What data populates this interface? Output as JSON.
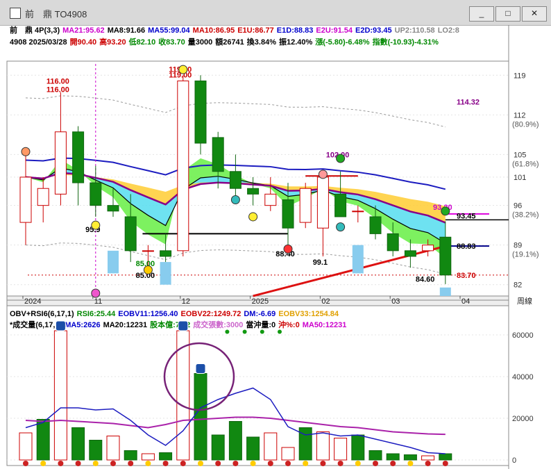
{
  "window": {
    "title": "前　鼎 TO4908",
    "buttons": [
      "_",
      "□",
      "✕"
    ]
  },
  "header": {
    "row1": [
      {
        "text": "前　鼎 4P(3,3)",
        "color": "#000000"
      },
      {
        "text": "MA21:95.62",
        "color": "#cc00cc"
      },
      {
        "text": "MA8:91.66",
        "color": "#000000"
      },
      {
        "text": "MA55:99.04",
        "color": "#0000cc"
      },
      {
        "text": "MA10:86.95",
        "color": "#cc0000"
      },
      {
        "text": "E1U:86.77",
        "color": "#cc0000"
      },
      {
        "text": "E1D:88.83",
        "color": "#0000cc"
      },
      {
        "text": "E2U:91.54",
        "color": "#cc00cc"
      },
      {
        "text": "E2D:93.45",
        "color": "#0000cc"
      },
      {
        "text": "UP2:110.58",
        "color": "#888888"
      },
      {
        "text": "LO2:8",
        "color": "#888888"
      }
    ],
    "row2": [
      {
        "text": "4908 2025/03/28",
        "color": "#000000"
      },
      {
        "text": "開90.40",
        "color": "#cc0000"
      },
      {
        "text": "高93.20",
        "color": "#cc0000"
      },
      {
        "text": "低82.10",
        "color": "#008800"
      },
      {
        "text": "收83.70",
        "color": "#008800"
      },
      {
        "text": "量3000",
        "color": "#000000"
      },
      {
        "text": "額26741",
        "color": "#000000"
      },
      {
        "text": "換3.84%",
        "color": "#000000"
      },
      {
        "text": "振12.40%",
        "color": "#000000"
      },
      {
        "text": "漲(-5.80)-6.48%",
        "color": "#008800"
      },
      {
        "text": "指數(-10.93)-4.31%",
        "color": "#008800"
      }
    ],
    "vol_row1": [
      {
        "text": "OBV+RSI6(6,17,1)",
        "color": "#000000"
      },
      {
        "text": "RSI6:25.44",
        "color": "#008800"
      },
      {
        "text": "EOBV11:1256.40",
        "color": "#0000cc"
      },
      {
        "text": "EOBV22:1249.72",
        "color": "#cc0000"
      },
      {
        "text": "DM:-6.69",
        "color": "#0000cc"
      },
      {
        "text": "EOBV33:1254.84",
        "color": "#e0a000"
      }
    ],
    "vol_row2": [
      {
        "text": "*成交量(6,17,1)",
        "color": "#000000"
      },
      {
        "text": "MA5:2626",
        "color": "#0000cc"
      },
      {
        "text": "MA20:12231",
        "color": "#000000"
      },
      {
        "text": "股本億:7.82",
        "color": "#008800"
      },
      {
        "text": "成交張數:3000",
        "color": "#cc66cc"
      },
      {
        "text": "當沖量:0",
        "color": "#000000"
      },
      {
        "text": "沖%:0",
        "color": "#cc0000"
      },
      {
        "text": "MA50:12231",
        "color": "#cc00cc"
      }
    ]
  },
  "chart_data": [
    {
      "type": "candlestick",
      "price_axis": {
        "ticks": [
          119,
          112,
          105,
          101,
          96,
          89,
          82
        ],
        "pct_labels": [
          {
            "price": 112,
            "text": "(80.9%)"
          },
          {
            "price": 105,
            "text": "(61.8%)"
          },
          {
            "price": 96,
            "text": "(38.2%)"
          },
          {
            "price": 89,
            "text": "(19.1%)"
          }
        ],
        "range": [
          80,
          121
        ]
      },
      "time_axis": [
        "2024",
        "11",
        "12",
        "2025",
        "02",
        "03",
        "04"
      ],
      "axis_title": "周線",
      "candles": [
        {
          "o": 93,
          "h": 106,
          "l": 89,
          "c": 101
        },
        {
          "o": 96,
          "h": 101,
          "l": 93,
          "c": 99
        },
        {
          "o": 98,
          "h": 116,
          "l": 96,
          "c": 109
        },
        {
          "o": 109,
          "h": 110,
          "l": 96,
          "c": 100
        },
        {
          "o": 100,
          "h": 103,
          "l": 94,
          "c": 96
        },
        {
          "o": 96,
          "h": 99,
          "l": 94,
          "c": 95
        },
        {
          "o": 94,
          "h": 98,
          "l": 86,
          "c": 88
        },
        {
          "o": 88,
          "h": 89,
          "l": 85,
          "c": 88
        },
        {
          "o": 88,
          "h": 91,
          "l": 86,
          "c": 87
        },
        {
          "o": 88,
          "h": 119,
          "l": 87,
          "c": 118
        },
        {
          "o": 118,
          "h": 119,
          "l": 105,
          "c": 107
        },
        {
          "o": 108,
          "h": 109,
          "l": 99,
          "c": 102
        },
        {
          "o": 102,
          "h": 105,
          "l": 97,
          "c": 99
        },
        {
          "o": 99,
          "h": 101,
          "l": 96,
          "c": 98
        },
        {
          "o": 96,
          "h": 101,
          "l": 95,
          "c": 98
        },
        {
          "o": 97,
          "h": 100,
          "l": 88,
          "c": 92
        },
        {
          "o": 93,
          "h": 100,
          "l": 92,
          "c": 99
        },
        {
          "o": 92,
          "h": 102,
          "l": 87,
          "c": 101
        },
        {
          "o": 98,
          "h": 102,
          "l": 94,
          "c": 94
        },
        {
          "o": 95,
          "h": 96,
          "l": 93,
          "c": 95
        },
        {
          "o": 94,
          "h": 96,
          "l": 90,
          "c": 91
        },
        {
          "o": 91,
          "h": 93,
          "l": 87,
          "c": 88
        },
        {
          "o": 88,
          "h": 90,
          "l": 85,
          "c": 87
        },
        {
          "o": 88,
          "h": 90,
          "l": 87,
          "c": 89
        },
        {
          "o": 90.4,
          "h": 93.2,
          "l": 82.1,
          "c": 83.7
        }
      ],
      "labels": [
        {
          "candle": 2,
          "price": 116,
          "text": "116.00",
          "color": "#cc0000"
        },
        {
          "candle": 2,
          "price": 117.5,
          "text": "116.00",
          "color": "#cc0000"
        },
        {
          "candle": 9,
          "price": 119.6,
          "text": "119.00",
          "color": "#cc0000"
        },
        {
          "candle": 9,
          "price": 118.6,
          "text": "119.00",
          "color": "#cc0000"
        },
        {
          "candle": 4,
          "price": 91.3,
          "text": "95.9",
          "color": "#000000"
        },
        {
          "candle": 7,
          "price": 83.2,
          "text": "85.00",
          "color": "#000000"
        },
        {
          "candle": 7,
          "price": 85.3,
          "text": "85.00",
          "color": "#008800"
        },
        {
          "candle": 15,
          "price": 87.0,
          "text": "88.40",
          "color": "#000000"
        },
        {
          "candle": 17,
          "price": 85.5,
          "text": "99.1",
          "color": "#000000"
        },
        {
          "candle": 18,
          "price": 104.5,
          "text": "102.00",
          "color": "#880088"
        },
        {
          "candle": 23,
          "price": 82.5,
          "text": "84.60",
          "color": "#000000"
        },
        {
          "candle": 24,
          "price": 95.2,
          "text": "93.20",
          "color": "#cc00cc"
        }
      ],
      "right_labels": [
        {
          "price": 114.32,
          "text": "114.32",
          "color": "#880088"
        },
        {
          "price": 93.45,
          "text": "93.45",
          "color": "#000000"
        },
        {
          "price": 88.83,
          "text": "88.83",
          "color": "#000000"
        },
        {
          "price": 83.7,
          "text": "83.70",
          "color": "#cc0000"
        }
      ]
    },
    {
      "type": "bar",
      "volume_axis": {
        "ticks": [
          60000,
          40000,
          20000,
          0
        ],
        "range": [
          0,
          66000
        ]
      },
      "volumes": [
        13000,
        19500,
        62000,
        15500,
        9500,
        11500,
        4500,
        3000,
        3500,
        62000,
        41500,
        12000,
        18500,
        11000,
        13000,
        6000,
        15500,
        13500,
        10500,
        12000,
        4500,
        3000,
        2500,
        2000,
        3000
      ],
      "up": [
        true,
        false,
        true,
        false,
        false,
        true,
        false,
        true,
        false,
        true,
        false,
        false,
        false,
        false,
        true,
        true,
        false,
        true,
        true,
        false,
        false,
        false,
        false,
        true,
        false
      ],
      "ma5": [
        15500,
        18000,
        25000,
        25000,
        24000,
        24500,
        19000,
        12000,
        7000,
        14000,
        25000,
        29000,
        32000,
        34500,
        29000,
        16000,
        12000,
        13000,
        11500,
        12000,
        10000,
        8000,
        6000,
        3500,
        3000
      ],
      "ma20": [
        19000,
        18500,
        19000,
        18500,
        18000,
        17500,
        16500,
        15500,
        17000,
        19000,
        19500,
        20000,
        20500,
        20500,
        20000,
        19000,
        18000,
        17000,
        16000,
        15500,
        14500,
        13500,
        13000,
        12500,
        12300
      ]
    }
  ]
}
